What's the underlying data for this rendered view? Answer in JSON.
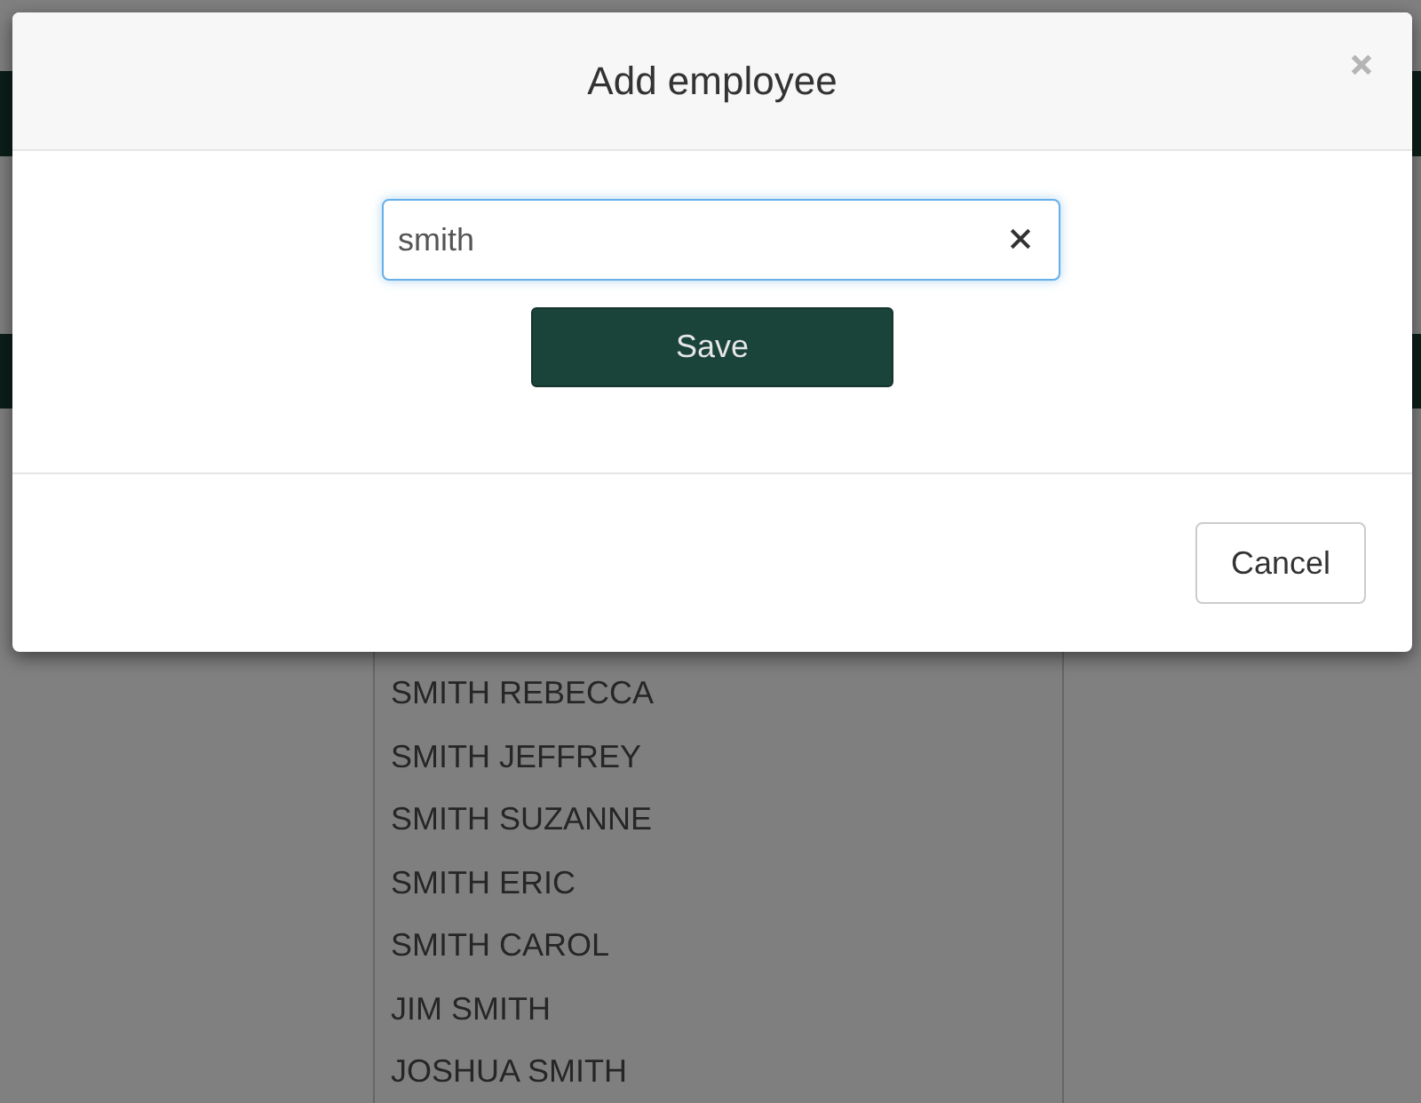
{
  "dialog": {
    "title": "Add employee",
    "search": {
      "value": "smith"
    },
    "save_label": "Save",
    "cancel_label": "Cancel"
  },
  "suggestions": [
    "SMITH REBECCA",
    "SMITH JEFFREY",
    "SMITH SUZANNE",
    "SMITH ERIC",
    "SMITH CAROL",
    "JIM SMITH",
    "JOSHUA SMITH"
  ]
}
